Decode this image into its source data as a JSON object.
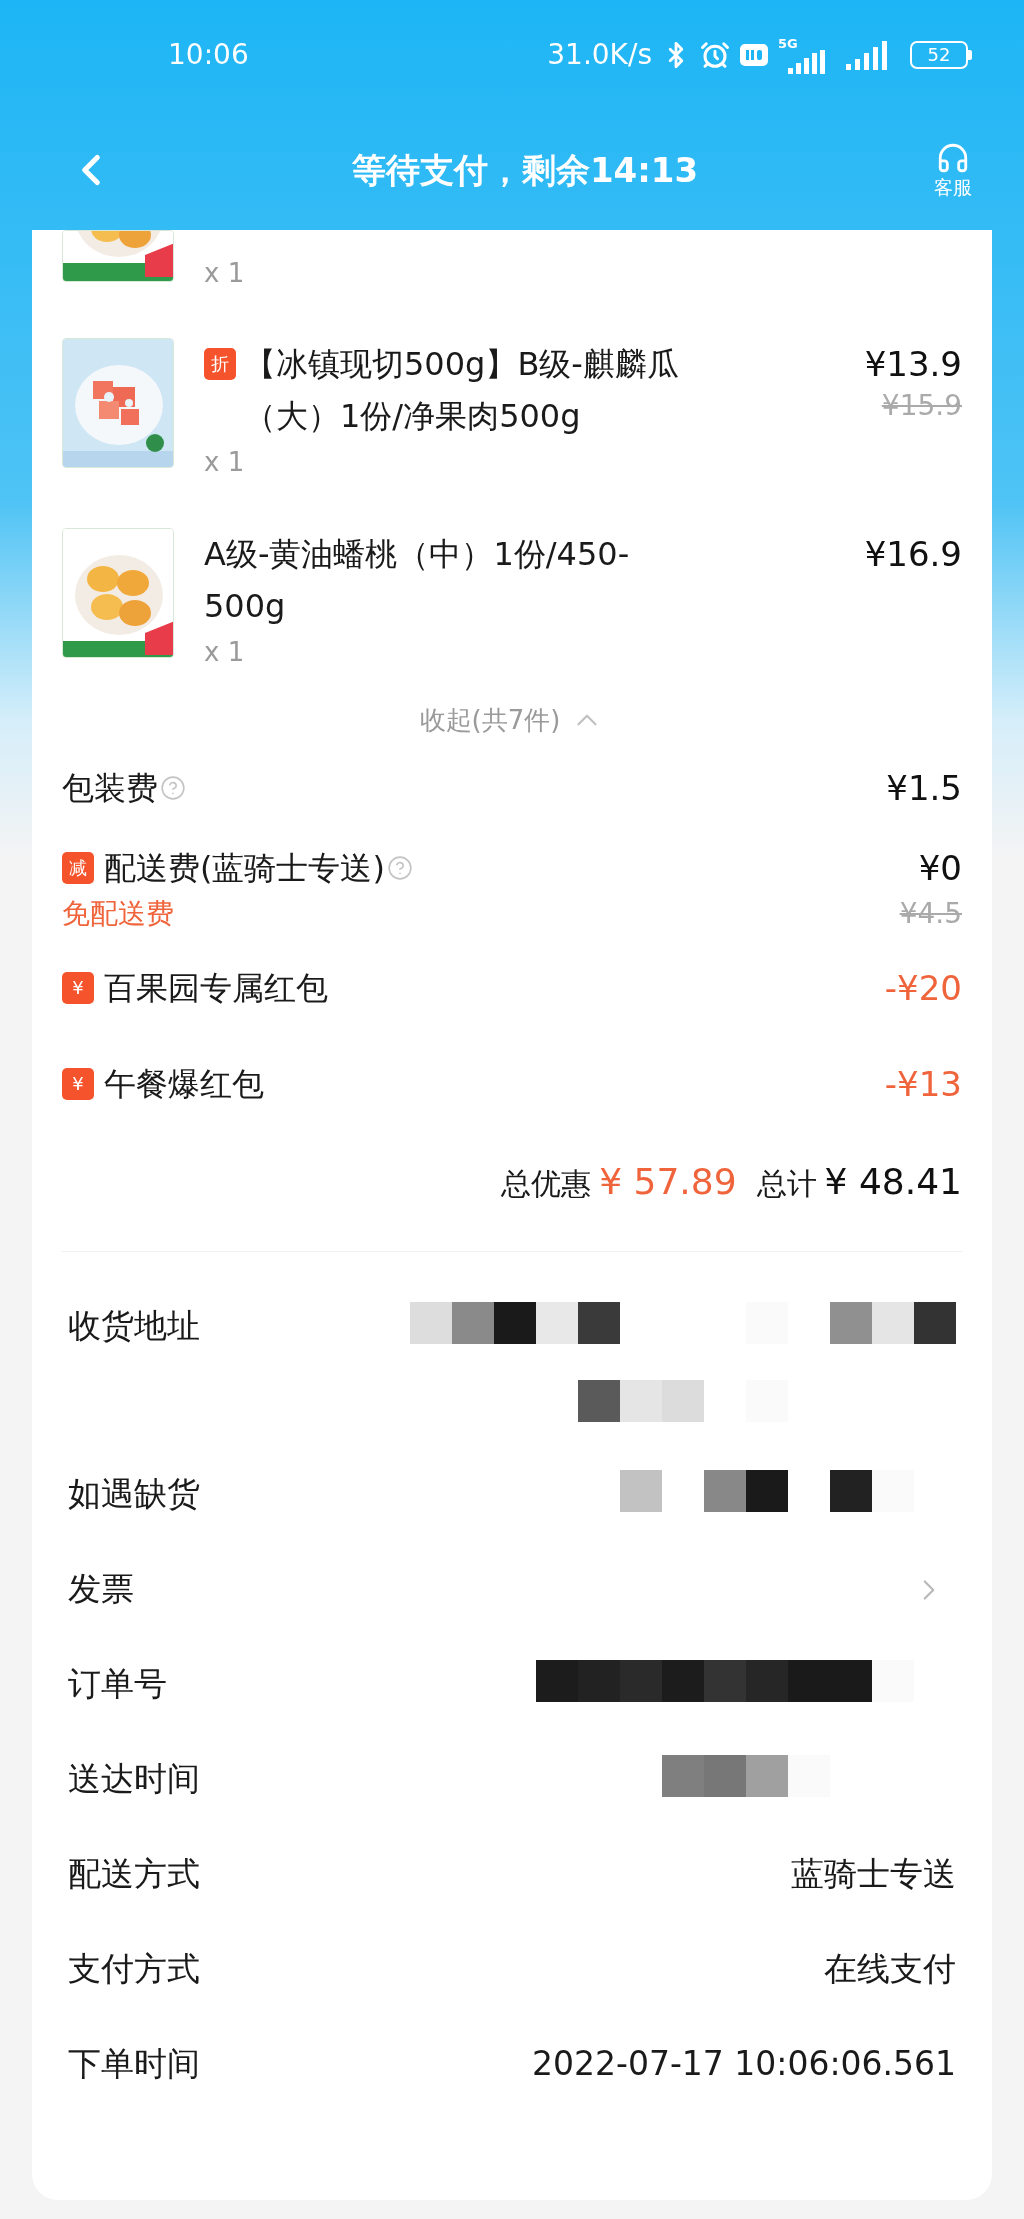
{
  "status_bar": {
    "time": "10:06",
    "network_speed": "31.0K/s",
    "network_type": "5G",
    "battery": "52"
  },
  "header": {
    "title": "等待支付，剩余14:13",
    "service_label": "客服"
  },
  "items": [
    {
      "kind": "partial",
      "qty": "x 1"
    },
    {
      "kind": "full",
      "badge": "折",
      "name": "【冰镇现切500g】B级-麒麟瓜（大）1份/净果肉500g",
      "price": "¥13.9",
      "original_price": "¥15.9",
      "qty": "x 1"
    },
    {
      "kind": "full",
      "name": "A级-黄油蟠桃（中）1份/450-500g",
      "price": "¥16.9",
      "qty": "x 1"
    }
  ],
  "collapse": "收起(共7件)",
  "fees": [
    {
      "kind": "fee",
      "label": "包装费",
      "help": true,
      "amount": "¥1.5"
    },
    {
      "kind": "discount",
      "badge": "减",
      "label": "配送费(蓝骑士专送)",
      "help": true,
      "note": "免配送费",
      "amount": "¥0",
      "original_amount": "¥4.5"
    },
    {
      "kind": "coupon",
      "badge": "¥",
      "label": "百果园专属红包",
      "help": false,
      "amount": "-¥20"
    },
    {
      "kind": "coupon",
      "badge": "¥",
      "label": "午餐爆红包",
      "help": false,
      "amount": "-¥13"
    }
  ],
  "totals": {
    "discount_label": "总优惠",
    "discount": "¥ 57.89",
    "total_label": "总计",
    "total": "¥ 48.41"
  },
  "details": [
    {
      "kind": "redacted",
      "label": "收货地址"
    },
    {
      "kind": "redacted",
      "label": "如遇缺货"
    },
    {
      "kind": "link",
      "label": "发票"
    },
    {
      "kind": "redacted",
      "label": "订单号"
    },
    {
      "kind": "redacted",
      "label": "送达时间"
    },
    {
      "kind": "text",
      "label": "配送方式",
      "value": "蓝骑士专送"
    },
    {
      "kind": "text",
      "label": "支付方式",
      "value": "在线支付"
    },
    {
      "kind": "text",
      "label": "下单时间",
      "value": "2022-07-17 10:06:06.561"
    }
  ]
}
